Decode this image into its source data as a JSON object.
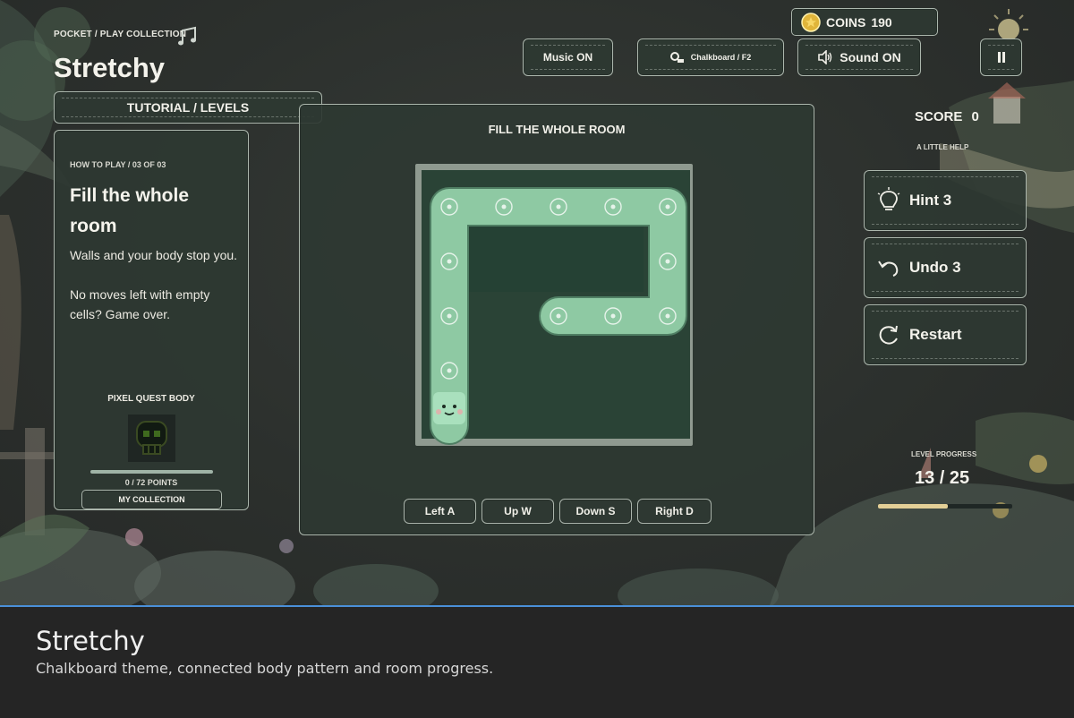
{
  "header": {
    "breadcrumb": "POCKET / PLAY COLLECTION",
    "title": "Stretchy",
    "tab_toggle": "TUTORIAL / LEVELS"
  },
  "top_bar": {
    "coins_label": "COINS",
    "coins_value": "190",
    "music": "Music ON",
    "theme": "Chalkboard / F2",
    "sound": "Sound ON",
    "pause_icon": "pause-icon"
  },
  "tutorial": {
    "step": "HOW TO PLAY / 03 OF 03",
    "heading": "Fill the whole room",
    "paragraphs": [
      "Walls and your body stop you.",
      "No moves left with empty cells? Game over."
    ],
    "collection_title": "PIXEL QUEST BODY",
    "points": "0 / 72 POINTS",
    "collection_button": "MY COLLECTION"
  },
  "play": {
    "title": "FILL THE WHOLE ROOM",
    "grid_size": 5,
    "body_path_cells": [
      [
        4,
        0
      ],
      [
        3,
        0
      ],
      [
        2,
        0
      ],
      [
        1,
        0
      ],
      [
        0,
        0
      ],
      [
        0,
        1
      ],
      [
        0,
        2
      ],
      [
        0,
        3
      ],
      [
        0,
        4
      ],
      [
        1,
        4
      ],
      [
        2,
        4
      ],
      [
        2,
        3
      ],
      [
        2,
        2
      ]
    ],
    "controls": [
      "Left A",
      "Up W",
      "Down S",
      "Right D"
    ]
  },
  "sidebar": {
    "score_label": "SCORE",
    "score_value": "0",
    "help_label": "A LITTLE HELP",
    "hint": "Hint 3",
    "undo": "Undo 3",
    "restart": "Restart",
    "level_label": "LEVEL PROGRESS",
    "level_value": "13 / 25",
    "level_fraction": 0.52
  },
  "caption": {
    "title": "Stretchy",
    "subtitle": "Chalkboard theme, connected body pattern and room progress."
  },
  "colors": {
    "board": "#2d312e",
    "panel": "#2e3832",
    "chalk": "#d7e1d7",
    "body": "#8ec9a3",
    "room_floor": "#2b4638",
    "progress": "#e3cf96",
    "accent_line": "#4a90d9"
  }
}
